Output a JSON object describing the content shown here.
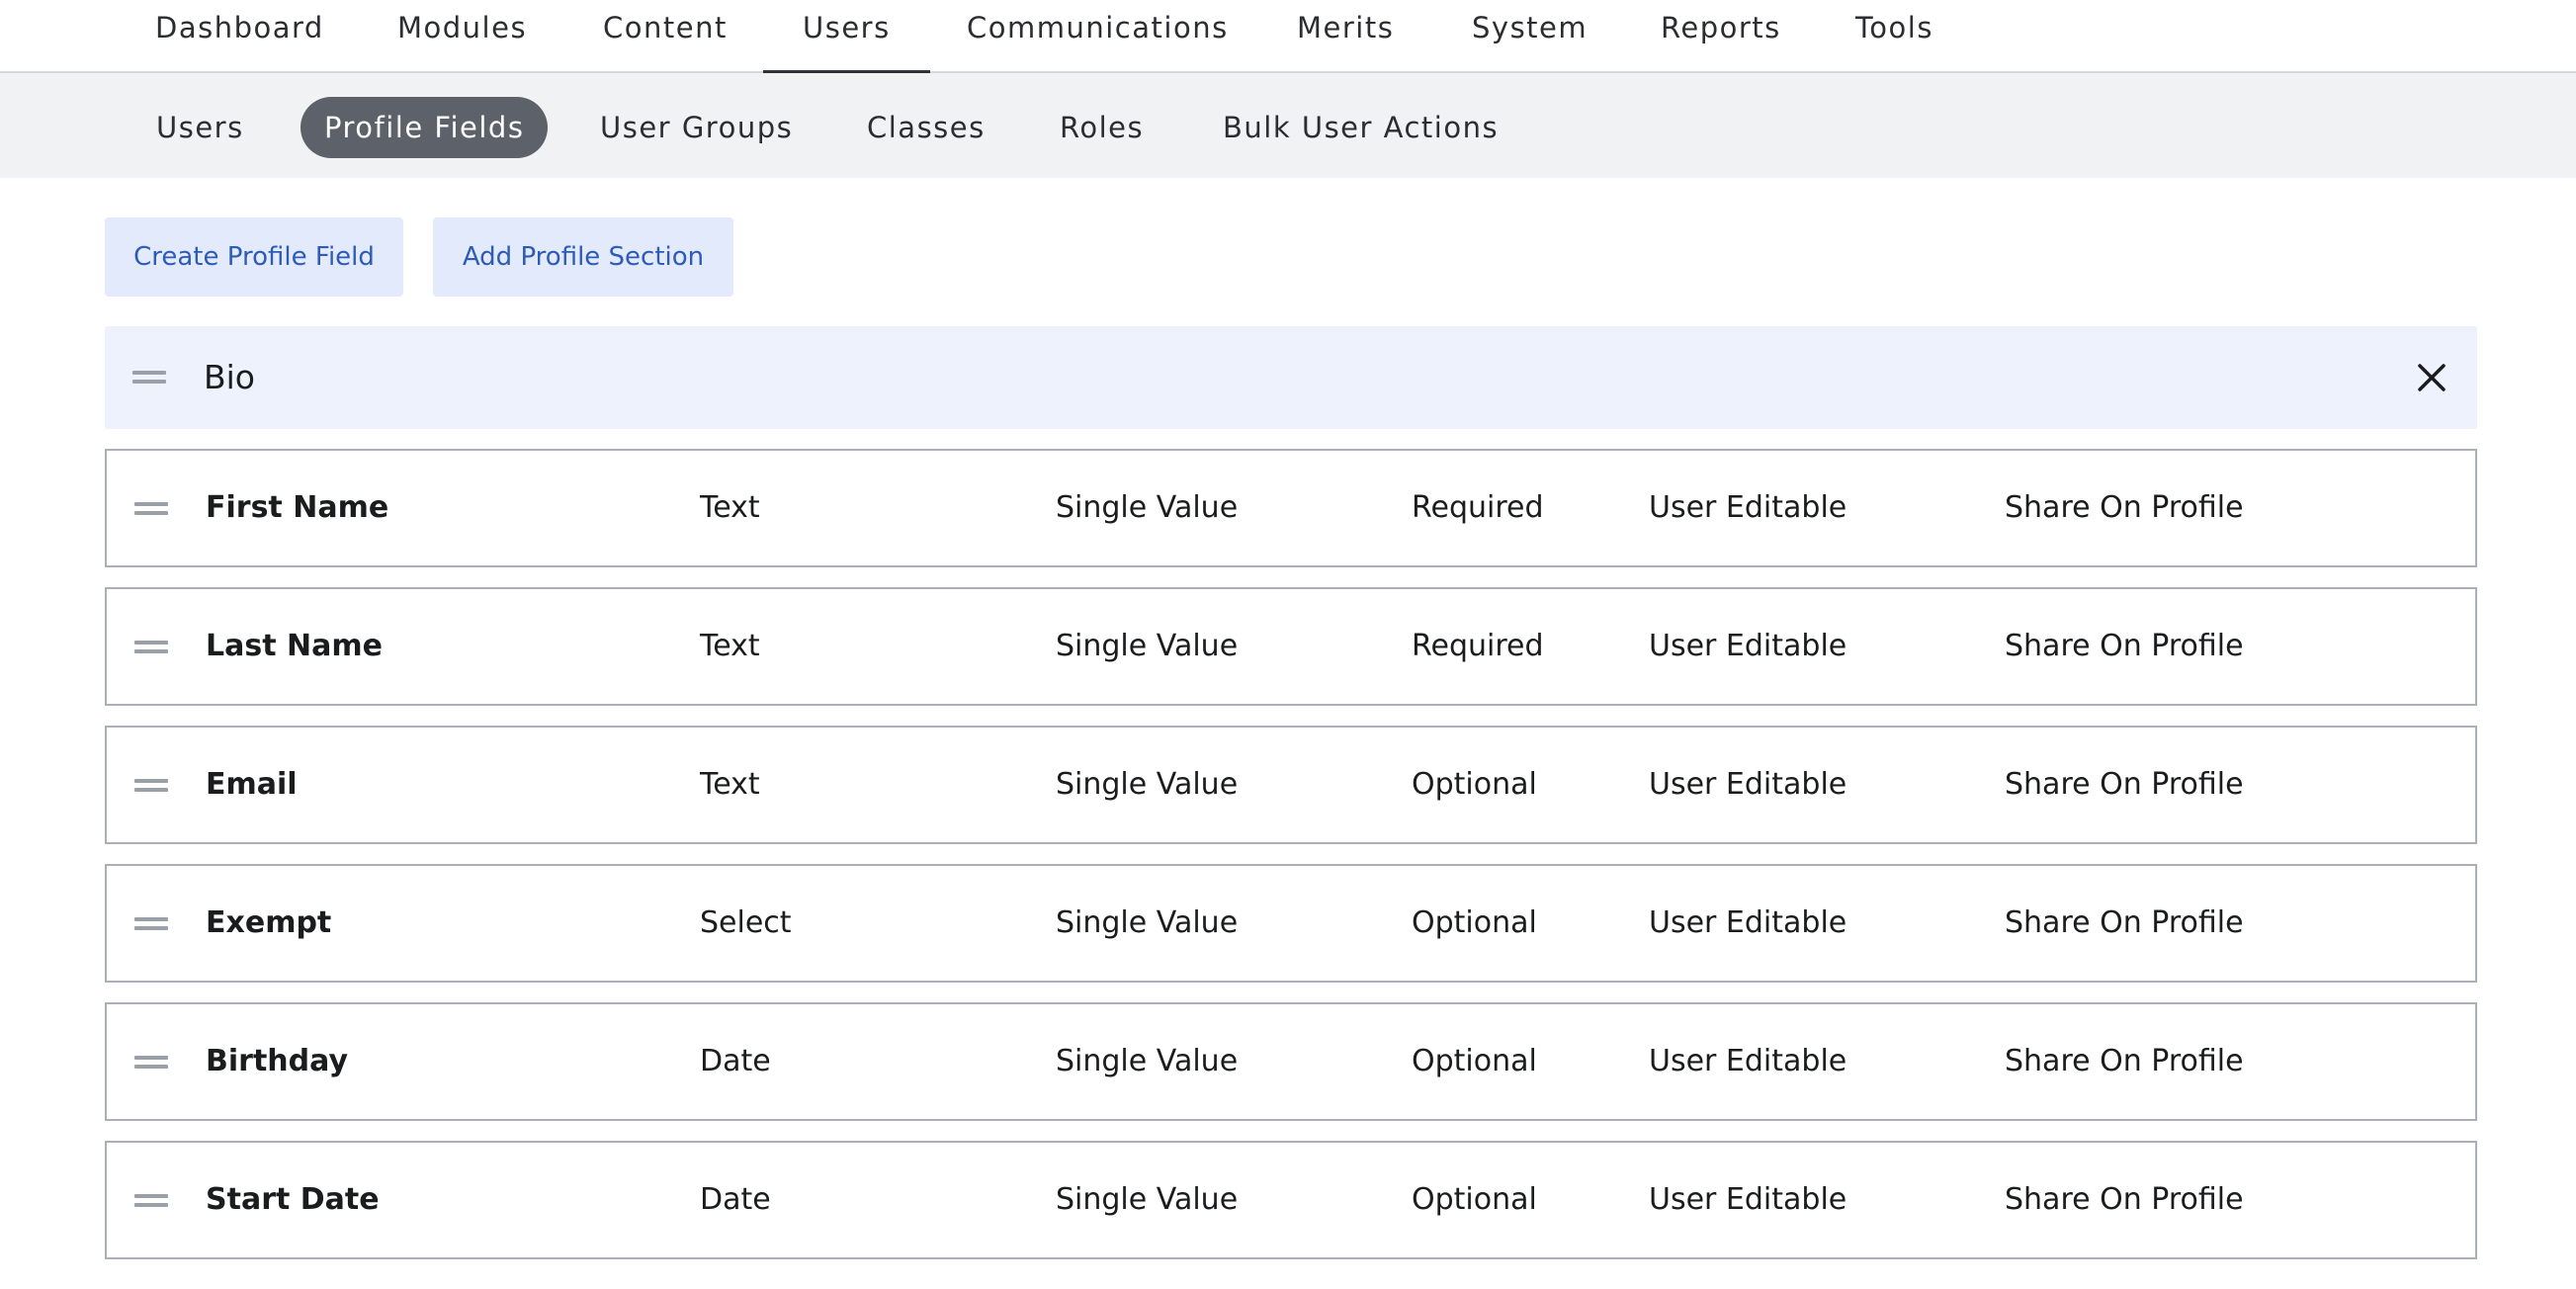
{
  "top_nav": [
    {
      "label": "Dashboard",
      "active": false
    },
    {
      "label": "Modules",
      "active": false
    },
    {
      "label": "Content",
      "active": false
    },
    {
      "label": "Users",
      "active": true
    },
    {
      "label": "Communications",
      "active": false
    },
    {
      "label": "Merits",
      "active": false
    },
    {
      "label": "System",
      "active": false
    },
    {
      "label": "Reports",
      "active": false
    },
    {
      "label": "Tools",
      "active": false
    }
  ],
  "sub_nav": [
    {
      "label": "Users",
      "active": false
    },
    {
      "label": "Profile Fields",
      "active": true
    },
    {
      "label": "User Groups",
      "active": false
    },
    {
      "label": "Classes",
      "active": false
    },
    {
      "label": "Roles",
      "active": false
    },
    {
      "label": "Bulk User Actions",
      "active": false
    }
  ],
  "actions": {
    "create_label": "Create Profile Field",
    "add_section_label": "Add Profile Section"
  },
  "section": {
    "title": "Bio",
    "drag_icon": "drag-handle-icon",
    "close_icon": "close-icon"
  },
  "fields": [
    {
      "name": "First Name",
      "type": "Text",
      "cardinality": "Single Value",
      "requirement": "Required",
      "editable": "User Editable",
      "sharing": "Share On Profile"
    },
    {
      "name": "Last Name",
      "type": "Text",
      "cardinality": "Single Value",
      "requirement": "Required",
      "editable": "User Editable",
      "sharing": "Share On Profile"
    },
    {
      "name": "Email",
      "type": "Text",
      "cardinality": "Single Value",
      "requirement": "Optional",
      "editable": "User Editable",
      "sharing": "Share On Profile"
    },
    {
      "name": "Exempt",
      "type": "Select",
      "cardinality": "Single Value",
      "requirement": "Optional",
      "editable": "User Editable",
      "sharing": "Share On Profile"
    },
    {
      "name": "Birthday",
      "type": "Date",
      "cardinality": "Single Value",
      "requirement": "Optional",
      "editable": "User Editable",
      "sharing": "Share On Profile"
    },
    {
      "name": "Start Date",
      "type": "Date",
      "cardinality": "Single Value",
      "requirement": "Optional",
      "editable": "User Editable",
      "sharing": "Share On Profile"
    }
  ],
  "colors": {
    "accent_text": "#2d5bb8",
    "button_bg": "#e3eafc",
    "section_bg": "#edf2fd",
    "active_pill": "#5d6169",
    "subnav_bg": "#f1f2f4"
  }
}
